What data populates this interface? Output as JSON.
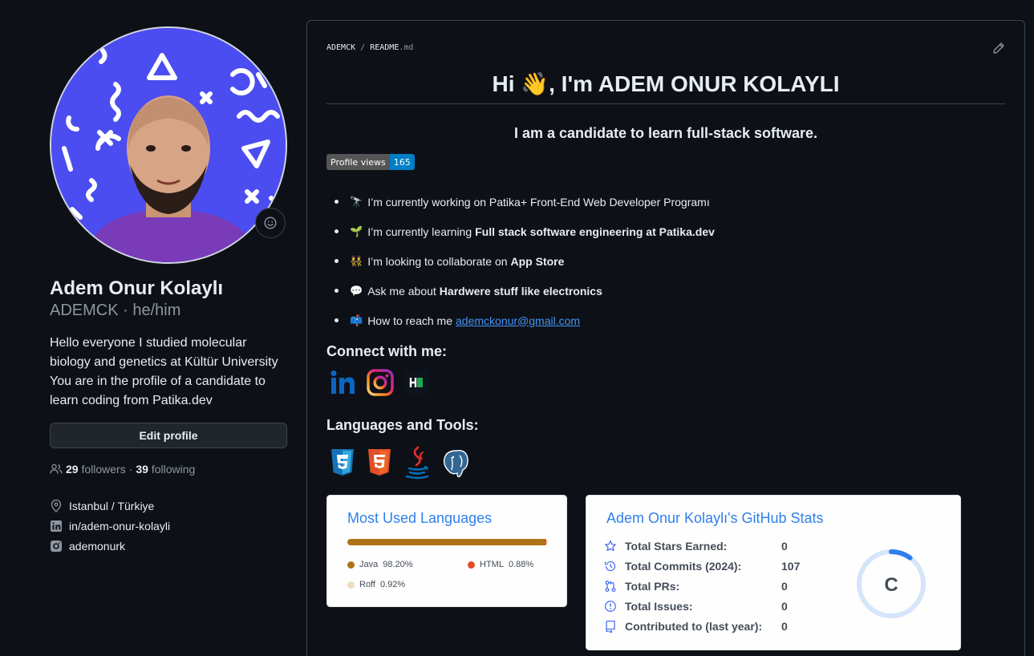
{
  "profile": {
    "full_name": "Adem Onur Kolaylı",
    "login": "ADEMCK",
    "pronouns": "he/him",
    "bio_lines": [
      "Hello everyone I studied molecular",
      "biology and genetics at Kültür University",
      "You are in the profile of a candidate to",
      "learn coding from Patika.dev"
    ],
    "edit_label": "Edit profile",
    "followers_count": "29",
    "followers_label": "followers",
    "following_count": "39",
    "following_label": "following",
    "location": "Istanbul / Türkiye",
    "linkedin": "in/adem-onur-kolayli",
    "instagram": "ademonurk"
  },
  "readme": {
    "crumb_user": "ADEMCK",
    "crumb_file": "README",
    "crumb_ext": ".md",
    "heading_pre": "Hi",
    "heading_emoji": "👋",
    "heading_post": ", I'm ADEM ONUR KOLAYLI",
    "subheading": "I am a candidate to learn full-stack software.",
    "badge_label": "Profile views",
    "badge_value": "165",
    "bullets": [
      {
        "emoji": "🔭",
        "text": "I’m currently working on Patika+ Front-End Web Developer Programı",
        "bold": ""
      },
      {
        "emoji": "🌱",
        "text": "I’m currently learning",
        "bold": "Full stack software engineering at Patika.dev"
      },
      {
        "emoji": "👯",
        "text": "I’m looking to collaborate on",
        "bold": "App Store"
      },
      {
        "emoji": "💬",
        "text": "Ask me about",
        "bold": "Hardwere stuff like electronics"
      },
      {
        "emoji": "📫",
        "text": "How to reach me",
        "link": "ademckonur@gmail.com"
      }
    ],
    "connect_title": "Connect with me:",
    "social_icons": [
      "linkedin-icon",
      "instagram-icon",
      "hackerrank-icon"
    ],
    "tools_title": "Languages and Tools:",
    "tool_icons": [
      "css3-icon",
      "html5-icon",
      "java-icon",
      "postgresql-icon"
    ]
  },
  "languages_card": {
    "title": "Most Used Languages",
    "langs": [
      {
        "name": "Java",
        "pct": "98.20%",
        "value": 98.2,
        "color": "#b07219"
      },
      {
        "name": "HTML",
        "pct": "0.88%",
        "value": 0.88,
        "color": "#e34c26"
      },
      {
        "name": "Roff",
        "pct": "0.92%",
        "value": 0.92,
        "color": "#ecdebe"
      }
    ]
  },
  "stats_card": {
    "title": "Adem Onur Kolaylı's GitHub Stats",
    "rows": [
      {
        "icon": "star-icon",
        "label": "Total Stars Earned:",
        "value": "0"
      },
      {
        "icon": "history-icon",
        "label": "Total Commits (2024):",
        "value": "107"
      },
      {
        "icon": "pull-request-icon",
        "label": "Total PRs:",
        "value": "0"
      },
      {
        "icon": "issue-icon",
        "label": "Total Issues:",
        "value": "0"
      },
      {
        "icon": "repo-icon",
        "label": "Contributed to (last year):",
        "value": "0"
      }
    ],
    "rank": "C",
    "rank_progress": 0.1,
    "accent": "#2f80ed"
  }
}
